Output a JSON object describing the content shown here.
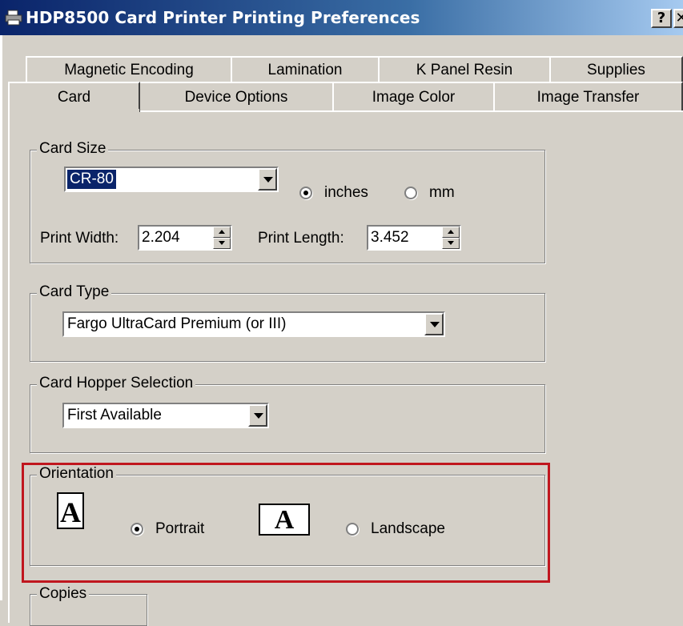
{
  "window": {
    "title": "HDP8500 Card Printer Printing Preferences",
    "help_label": "?",
    "close_label": "✕",
    "title_icon": "printer-icon"
  },
  "tabs": {
    "row1": [
      "Magnetic Encoding",
      "Lamination",
      "K Panel Resin",
      "Supplies"
    ],
    "row2": [
      "Card",
      "Device Options",
      "Image Color",
      "Image Transfer"
    ],
    "active": "Card"
  },
  "card_size": {
    "legend": "Card Size",
    "selected": "CR-80",
    "unit_inches": "inches",
    "unit_mm": "mm",
    "selected_unit": "inches",
    "print_width_label": "Print Width:",
    "print_width": "2.204",
    "print_length_label": "Print Length:",
    "print_length": "3.452"
  },
  "card_type": {
    "legend": "Card Type",
    "selected": "Fargo UltraCard Premium (or III)"
  },
  "hopper": {
    "legend": "Card Hopper Selection",
    "selected": "First Available"
  },
  "orientation": {
    "legend": "Orientation",
    "portrait_label": "Portrait",
    "landscape_label": "Landscape",
    "selected": "Portrait",
    "icon_glyph": "A",
    "highlight_color": "#c0161e"
  },
  "copies": {
    "legend": "Copies"
  }
}
